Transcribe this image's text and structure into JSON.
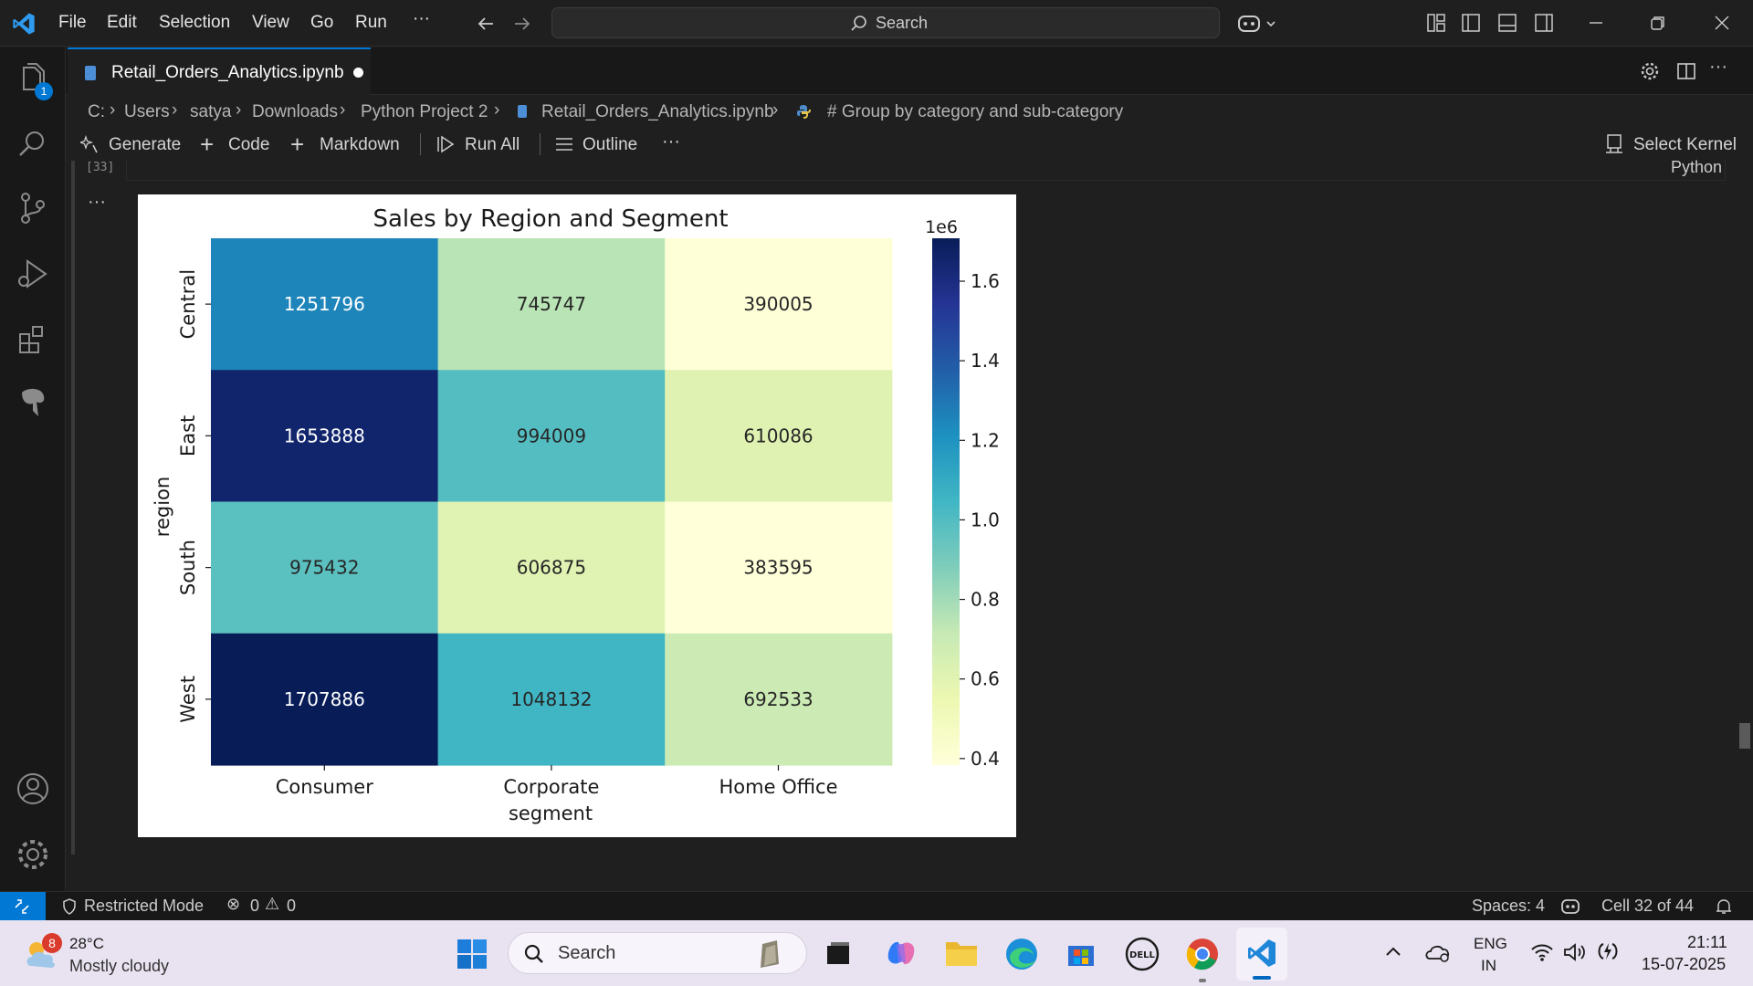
{
  "menu": {
    "file": "File",
    "edit": "Edit",
    "selection": "Selection",
    "view": "View",
    "go": "Go",
    "run": "Run",
    "more": "···"
  },
  "search": {
    "label": "Search"
  },
  "activity": {
    "explorer_badge": "1"
  },
  "tab": {
    "title": "Retail_Orders_Analytics.ipynb"
  },
  "breadcrumb": {
    "p0": "C:",
    "p1": "Users",
    "p2": "satya",
    "p3": "Downloads",
    "p4": "Python Project 2",
    "p5": "Retail_Orders_Analytics.ipynb",
    "p6": "# Group by category and sub-category"
  },
  "toolbar": {
    "generate": "Generate",
    "code": "Code",
    "markdown": "Markdown",
    "run_all": "Run All",
    "outline": "Outline",
    "more": "···",
    "kernel": "Select Kernel"
  },
  "cell": {
    "exec_count": "[33]",
    "language": "Python",
    "output_more": "···"
  },
  "chart_data": {
    "type": "heatmap",
    "title": "Sales by Region and Segment",
    "xlabel": "segment",
    "ylabel": "region",
    "x_categories": [
      "Consumer",
      "Corporate",
      "Home Office"
    ],
    "y_categories": [
      "Central",
      "East",
      "South",
      "West"
    ],
    "values": [
      [
        1251796,
        745747,
        390005
      ],
      [
        1653888,
        994009,
        610086
      ],
      [
        975432,
        606875,
        383595
      ],
      [
        1707886,
        1048132,
        692533
      ]
    ],
    "colormap": "YlGnBu",
    "colorbar": {
      "multiplier": "1e6",
      "ticks": [
        "0.4",
        "0.6",
        "0.8",
        "1.0",
        "1.2",
        "1.4",
        "1.6"
      ],
      "tick_values": [
        0.4,
        0.6,
        0.8,
        1.0,
        1.2,
        1.4,
        1.6
      ],
      "range": [
        0.383595,
        1.707886
      ]
    }
  },
  "status": {
    "restricted": "Restricted Mode",
    "errors": "0",
    "warnings": "0",
    "spaces": "Spaces: 4",
    "cell_pos": "Cell 32 of 44"
  },
  "taskbar": {
    "weather_badge": "8",
    "temperature": "28°C",
    "condition": "Mostly cloudy",
    "search": "Search",
    "lang_top": "ENG",
    "lang_bottom": "IN",
    "time": "21:11",
    "date": "15-07-2025"
  }
}
